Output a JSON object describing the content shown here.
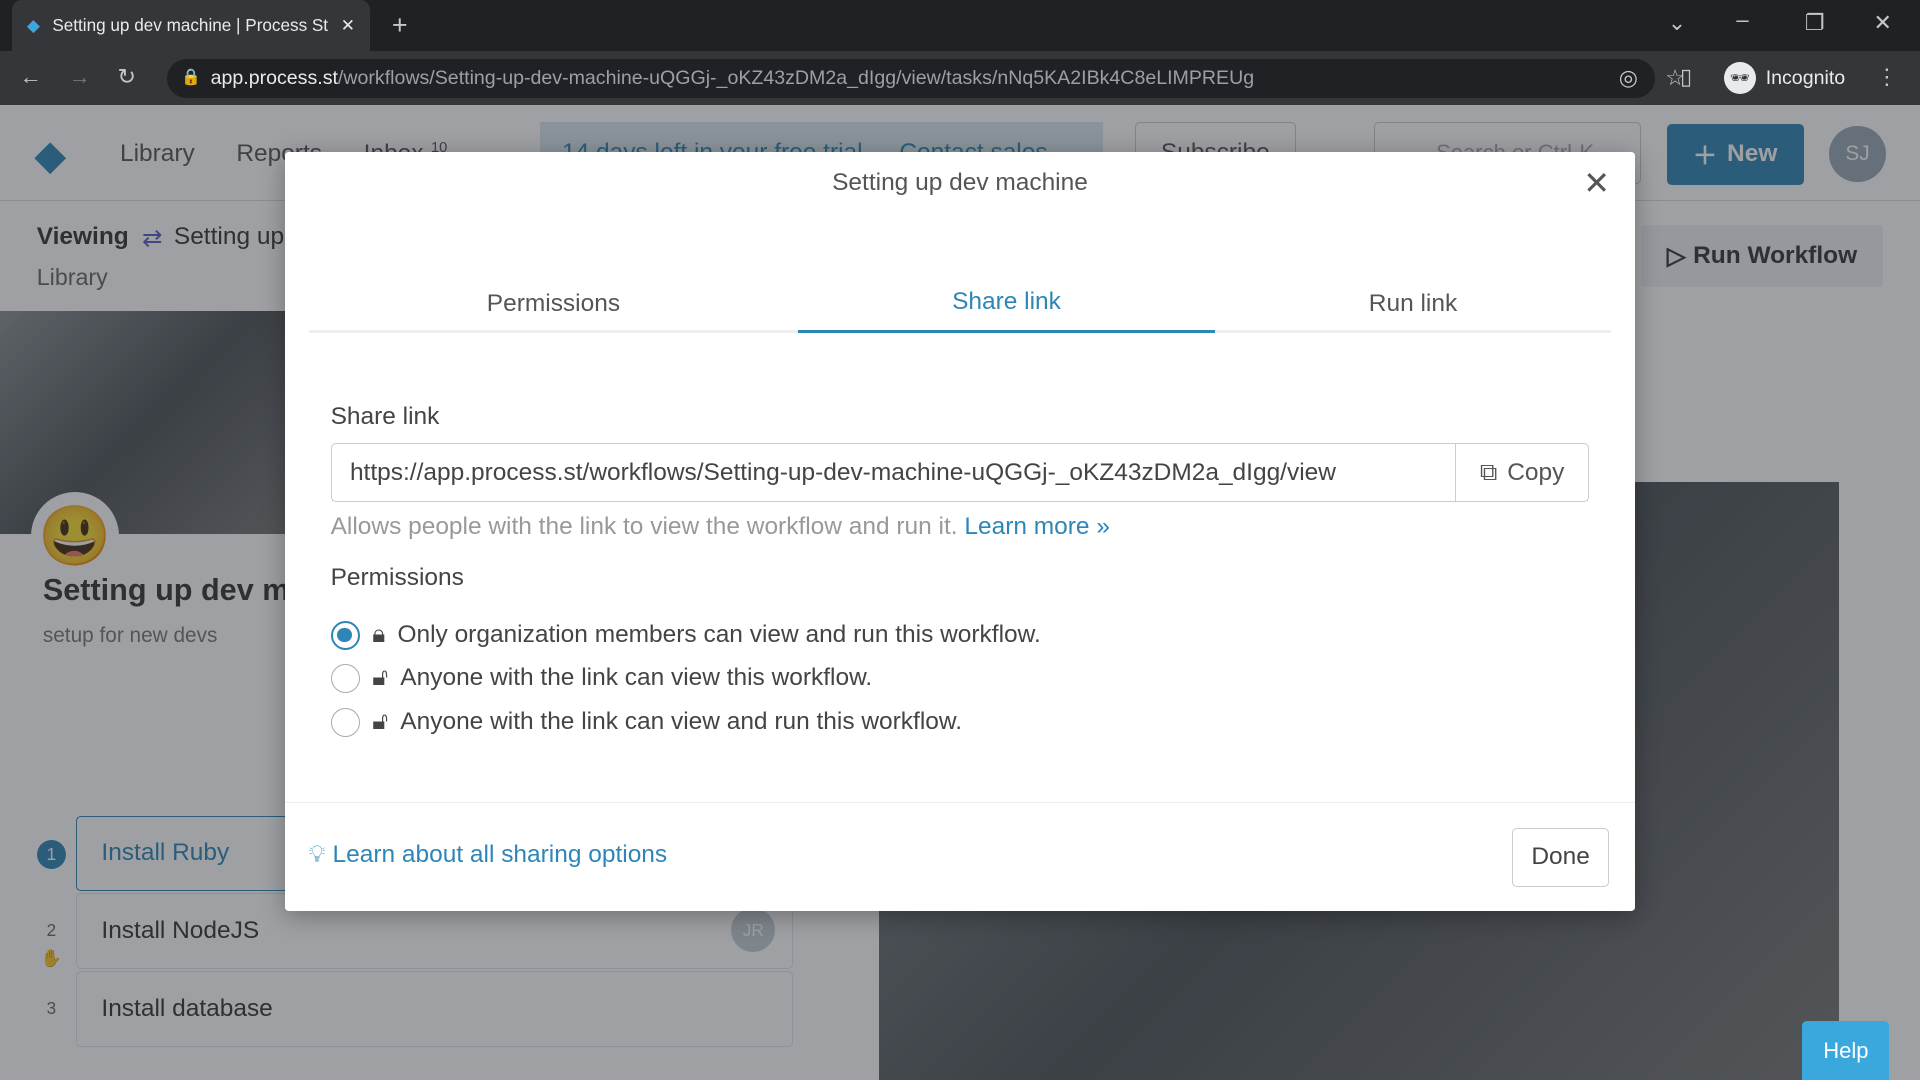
{
  "browser": {
    "tab_title": "Setting up dev machine | Process Street",
    "url_host": "app.process.st",
    "url_path": "/workflows/Setting-up-dev-machine-uQGGj-_oKZ43zDM2a_dIgg/view/tasks/nNq5KA2IBk4C8eLIMPREUg",
    "profile": "Incognito"
  },
  "nav": {
    "library": "Library",
    "reports": "Reports",
    "inbox": "Inbox",
    "inbox_count": "10",
    "trial": "14 days left in your free trial",
    "contact": "Contact sales",
    "subscribe": "Subscribe",
    "search_placeholder": "Search or Ctrl-K",
    "new": "New",
    "avatar": "SJ"
  },
  "page": {
    "viewing": "Viewing",
    "workflow": "Setting up dev machine",
    "breadcrumb": "Library",
    "title": "Setting up dev machine",
    "subtitle": "setup for new devs",
    "run": "Run Workflow",
    "steps": [
      {
        "num": "1",
        "label": "Install Ruby"
      },
      {
        "num": "2",
        "label": "Install NodeJS",
        "assignee": "JR"
      },
      {
        "num": "3",
        "label": "Install database"
      }
    ]
  },
  "modal": {
    "title": "Setting up dev machine",
    "tabs": [
      {
        "label": "Permissions"
      },
      {
        "label": "Share link",
        "active": true
      },
      {
        "label": "Run link"
      }
    ],
    "share_label": "Share link",
    "share_url": "https://app.process.st/workflows/Setting-up-dev-machine-uQGGj-_oKZ43zDM2a_dIgg/view",
    "copy": "Copy",
    "help_text": "Allows people with the link to view the workflow and run it.",
    "learn_more": "Learn more »",
    "permissions_label": "Permissions",
    "options": [
      {
        "label": "Only organization members can view and run this workflow.",
        "selected": true,
        "icon": "lock-icon"
      },
      {
        "label": "Anyone with the link can view this workflow.",
        "selected": false,
        "icon": "unlock-icon"
      },
      {
        "label": "Anyone with the link can view and run this workflow.",
        "selected": false,
        "icon": "unlock-icon"
      }
    ],
    "learn_all": "Learn about all sharing options",
    "done": "Done"
  },
  "help": "Help",
  "colors": {
    "accent": "#2e86b7",
    "help": "#3aa7dd"
  }
}
